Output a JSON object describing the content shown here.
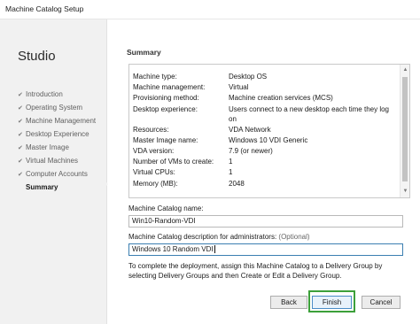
{
  "window": {
    "title": "Machine Catalog Setup"
  },
  "sidebar": {
    "app_name": "Studio",
    "steps": [
      {
        "label": "Introduction",
        "completed": true
      },
      {
        "label": "Operating System",
        "completed": true
      },
      {
        "label": "Machine Management",
        "completed": true
      },
      {
        "label": "Desktop Experience",
        "completed": true
      },
      {
        "label": "Master Image",
        "completed": true
      },
      {
        "label": "Virtual Machines",
        "completed": true
      },
      {
        "label": "Computer Accounts",
        "completed": true
      },
      {
        "label": "Summary",
        "completed": false,
        "active": true
      }
    ],
    "check_glyph": "✔"
  },
  "main": {
    "heading": "Summary",
    "summary": [
      {
        "key": "Machine type:",
        "value": "Desktop OS"
      },
      {
        "key": "Machine management:",
        "value": "Virtual"
      },
      {
        "key": "Provisioning method:",
        "value": "Machine creation services (MCS)"
      },
      {
        "key": "Desktop experience:",
        "value": "Users connect to a new desktop each time they log on"
      },
      {
        "key": "Resources:",
        "value": "VDA Network"
      },
      {
        "key": "Master Image name:",
        "value": "Windows 10 VDI Generic"
      },
      {
        "key": "VDA version:",
        "value": "7.9 (or newer)"
      },
      {
        "key": "Number of VMs to create:",
        "value": "1"
      },
      {
        "key": "Virtual CPUs:",
        "value": "1"
      },
      {
        "key": "Memory (MB):",
        "value": "2048"
      }
    ],
    "catalog_name_label": "Machine Catalog name:",
    "catalog_name_value": "Win10-Random-VDI",
    "description_label": "Machine Catalog description for administrators:",
    "description_optional": "(Optional)",
    "description_value": "Windows 10 Random VDI",
    "info_text": "To complete the deployment, assign this Machine Catalog to a Delivery Group by selecting Delivery Groups and then Create or Edit a Delivery Group."
  },
  "buttons": {
    "back": "Back",
    "finish": "Finish",
    "cancel": "Cancel"
  },
  "colors": {
    "highlight": "#3ca03a",
    "focus_border": "#3c7fb1",
    "sidebar_bg": "#f1f1f1"
  }
}
